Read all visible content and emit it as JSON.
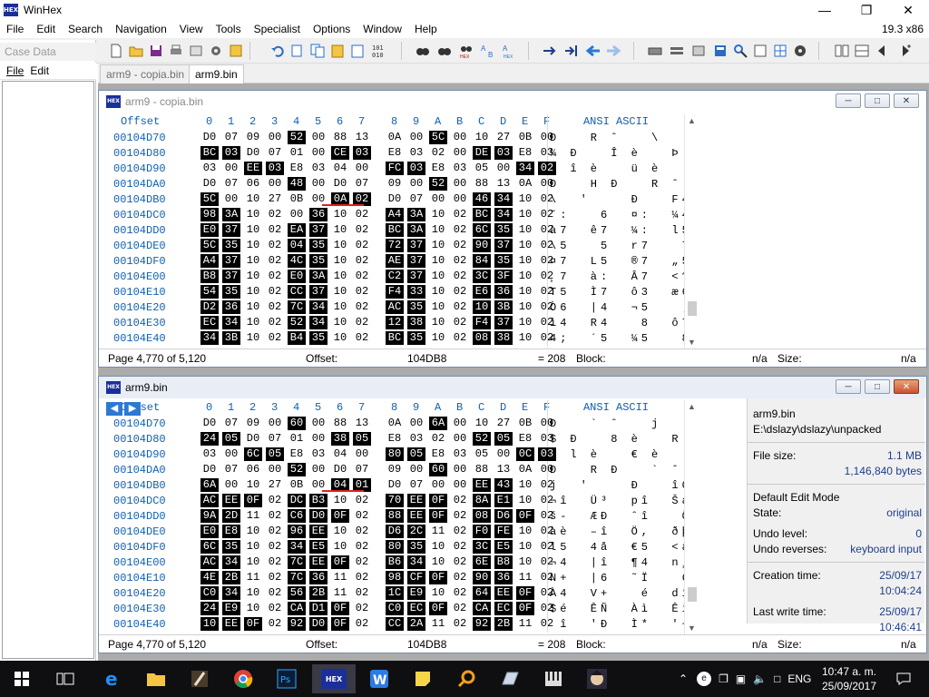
{
  "app": {
    "title": "WinHex",
    "logo_text": "HEX",
    "version": "19.3 x86"
  },
  "menu": [
    "File",
    "Edit",
    "Search",
    "Navigation",
    "View",
    "Tools",
    "Specialist",
    "Options",
    "Window",
    "Help"
  ],
  "case_panel": {
    "title": "Case Data",
    "menu": [
      "File",
      "Edit"
    ]
  },
  "tabs": [
    {
      "label": "arm9 - copia.bin",
      "active": false
    },
    {
      "label": "arm9.bin",
      "active": true
    }
  ],
  "hex_header": {
    "offset": "Offset",
    "columns": [
      "0",
      "1",
      "2",
      "3",
      "4",
      "5",
      "6",
      "7",
      "8",
      "9",
      "A",
      "B",
      "C",
      "D",
      "E",
      "F"
    ],
    "ascii": "ANSI ASCII"
  },
  "window1": {
    "title": "arm9 - copia.bin",
    "rows": [
      {
        "offset": "00104D70",
        "bytes": [
          "D0",
          "07",
          "09",
          "00",
          "52",
          "00",
          "88",
          "13",
          "0A",
          "00",
          "5C",
          "00",
          "10",
          "27",
          "0B",
          "00"
        ],
        "hi": [
          4,
          10
        ],
        "ascii": "Ð   R ˆ   \\  '"
      },
      {
        "offset": "00104D80",
        "bytes": [
          "BC",
          "03",
          "D0",
          "07",
          "01",
          "00",
          "CE",
          "03",
          "E8",
          "03",
          "02",
          "00",
          "DE",
          "03",
          "E8",
          "03"
        ],
        "hi": [
          0,
          1,
          6,
          7,
          12,
          13
        ],
        "ascii": "¼ Ð   Î è   Þ è"
      },
      {
        "offset": "00104D90",
        "bytes": [
          "03",
          "00",
          "EE",
          "03",
          "E8",
          "03",
          "04",
          "00",
          "FC",
          "03",
          "E8",
          "03",
          "05",
          "00",
          "34",
          "02"
        ],
        "hi": [
          2,
          3,
          8,
          9,
          14,
          15
        ],
        "ascii": "  î è   ü è   4"
      },
      {
        "offset": "00104DA0",
        "bytes": [
          "D0",
          "07",
          "06",
          "00",
          "48",
          "00",
          "D0",
          "07",
          "09",
          "00",
          "52",
          "00",
          "88",
          "13",
          "0A",
          "00"
        ],
        "hi": [
          4,
          10
        ],
        "ascii": "Ð   H Ð   R ˆ"
      },
      {
        "offset": "00104DB0",
        "bytes": [
          "5C",
          "00",
          "10",
          "27",
          "0B",
          "00",
          "0A",
          "02",
          "D0",
          "07",
          "00",
          "00",
          "46",
          "34",
          "10",
          "02"
        ],
        "hi": [
          0,
          6,
          7,
          12,
          13
        ],
        "ascii": "\\  '    Ð   F4"
      },
      {
        "offset": "00104DC0",
        "bytes": [
          "98",
          "3A",
          "10",
          "02",
          "00",
          "36",
          "10",
          "02",
          "A4",
          "3A",
          "10",
          "02",
          "BC",
          "34",
          "10",
          "02"
        ],
        "hi": [
          0,
          1,
          5,
          8,
          9,
          12,
          13
        ],
        "ascii": "˜:   6  ¤:  ¼4"
      },
      {
        "offset": "00104DD0",
        "bytes": [
          "E0",
          "37",
          "10",
          "02",
          "EA",
          "37",
          "10",
          "02",
          "BC",
          "3A",
          "10",
          "02",
          "6C",
          "35",
          "10",
          "02"
        ],
        "hi": [
          0,
          1,
          4,
          5,
          8,
          9,
          12,
          13
        ],
        "ascii": "à7  ê7  ¼:  l5"
      },
      {
        "offset": "00104DE0",
        "bytes": [
          "5C",
          "35",
          "10",
          "02",
          "04",
          "35",
          "10",
          "02",
          "72",
          "37",
          "10",
          "02",
          "90",
          "37",
          "10",
          "02"
        ],
        "hi": [
          0,
          1,
          4,
          5,
          8,
          9,
          12,
          13
        ],
        "ascii": "\\5   5  r7   7"
      },
      {
        "offset": "00104DF0",
        "bytes": [
          "A4",
          "37",
          "10",
          "02",
          "4C",
          "35",
          "10",
          "02",
          "AE",
          "37",
          "10",
          "02",
          "84",
          "35",
          "10",
          "02"
        ],
        "hi": [
          0,
          1,
          4,
          5,
          8,
          9,
          12,
          13
        ],
        "ascii": "¤7  L5  ®7  „5"
      },
      {
        "offset": "00104E00",
        "bytes": [
          "B8",
          "37",
          "10",
          "02",
          "E0",
          "3A",
          "10",
          "02",
          "C2",
          "37",
          "10",
          "02",
          "3C",
          "3F",
          "10",
          "02"
        ],
        "hi": [
          0,
          1,
          4,
          5,
          8,
          9,
          12,
          13
        ],
        "ascii": "¸7  à:  Â7  <?"
      },
      {
        "offset": "00104E10",
        "bytes": [
          "54",
          "35",
          "10",
          "02",
          "CC",
          "37",
          "10",
          "02",
          "F4",
          "33",
          "10",
          "02",
          "E6",
          "36",
          "10",
          "02"
        ],
        "hi": [
          0,
          1,
          4,
          5,
          8,
          9,
          12,
          13
        ],
        "ascii": "T5  Ì7  ô3  æ6"
      },
      {
        "offset": "00104E20",
        "bytes": [
          "D2",
          "36",
          "10",
          "02",
          "7C",
          "34",
          "10",
          "02",
          "AC",
          "35",
          "10",
          "02",
          "10",
          "3B",
          "10",
          "02"
        ],
        "hi": [
          0,
          1,
          4,
          5,
          8,
          9,
          12,
          13
        ],
        "ascii": "Ò6  |4  ¬5   ;"
      },
      {
        "offset": "00104E30",
        "bytes": [
          "EC",
          "34",
          "10",
          "02",
          "52",
          "34",
          "10",
          "02",
          "12",
          "38",
          "10",
          "02",
          "F4",
          "37",
          "10",
          "02"
        ],
        "hi": [
          0,
          1,
          4,
          5,
          8,
          9,
          12,
          13
        ],
        "ascii": "ì4  R4   8  ô7"
      },
      {
        "offset": "00104E40",
        "bytes": [
          "34",
          "3B",
          "10",
          "02",
          "B4",
          "35",
          "10",
          "02",
          "BC",
          "35",
          "10",
          "02",
          "08",
          "38",
          "10",
          "02"
        ],
        "hi": [
          0,
          1,
          4,
          5,
          8,
          9,
          12,
          13
        ],
        "ascii": "4;  ´5  ¼5   8"
      }
    ],
    "status": {
      "page": "Page 4,770 of 5,120",
      "offset_label": "Offset:",
      "offset_value": "104DB8",
      "value": "= 208",
      "block_label": "Block:",
      "block_value": "n/a",
      "size_label": "Size:",
      "size_value": "n/a"
    }
  },
  "window2": {
    "title": "arm9.bin",
    "rows": [
      {
        "offset": "00104D70",
        "bytes": [
          "D0",
          "07",
          "09",
          "00",
          "60",
          "00",
          "88",
          "13",
          "0A",
          "00",
          "6A",
          "00",
          "10",
          "27",
          "0B",
          "00"
        ],
        "hi": [
          4,
          10
        ],
        "ascii": "Ð   ` ˆ   j  '"
      },
      {
        "offset": "00104D80",
        "bytes": [
          "24",
          "05",
          "D0",
          "07",
          "01",
          "00",
          "38",
          "05",
          "E8",
          "03",
          "02",
          "00",
          "52",
          "05",
          "E8",
          "03"
        ],
        "hi": [
          0,
          1,
          6,
          7,
          12,
          13
        ],
        "ascii": "$ Ð   8 è   R è"
      },
      {
        "offset": "00104D90",
        "bytes": [
          "03",
          "00",
          "6C",
          "05",
          "E8",
          "03",
          "04",
          "00",
          "80",
          "05",
          "E8",
          "03",
          "05",
          "00",
          "0C",
          "03"
        ],
        "hi": [
          2,
          3,
          8,
          9,
          14,
          15
        ],
        "ascii": "  l è   € è"
      },
      {
        "offset": "00104DA0",
        "bytes": [
          "D0",
          "07",
          "06",
          "00",
          "52",
          "00",
          "D0",
          "07",
          "09",
          "00",
          "60",
          "00",
          "88",
          "13",
          "0A",
          "00"
        ],
        "hi": [
          4,
          10
        ],
        "ascii": "Ð   R Ð   ` ˆ"
      },
      {
        "offset": "00104DB0",
        "bytes": [
          "6A",
          "00",
          "10",
          "27",
          "0B",
          "00",
          "04",
          "01",
          "D0",
          "07",
          "00",
          "00",
          "EE",
          "43",
          "10",
          "02"
        ],
        "hi": [
          0,
          6,
          7,
          12,
          13
        ],
        "ascii": "j  '    Ð   îC"
      },
      {
        "offset": "00104DC0",
        "bytes": [
          "AC",
          "EE",
          "0F",
          "02",
          "DC",
          "B3",
          "10",
          "02",
          "70",
          "EE",
          "0F",
          "02",
          "8A",
          "E1",
          "10",
          "02"
        ],
        "hi": [
          0,
          1,
          2,
          4,
          5,
          8,
          9,
          10,
          12,
          13
        ],
        "ascii": "¬î  Ü³  pî  Šá"
      },
      {
        "offset": "00104DD0",
        "bytes": [
          "9A",
          "2D",
          "11",
          "02",
          "C6",
          "D0",
          "0F",
          "02",
          "88",
          "EE",
          "0F",
          "02",
          "08",
          "D6",
          "0F",
          "02"
        ],
        "hi": [
          0,
          1,
          4,
          5,
          6,
          8,
          9,
          10,
          12,
          13,
          14
        ],
        "ascii": "š-  ÆÐ  ˆî   Ö"
      },
      {
        "offset": "00104DE0",
        "bytes": [
          "E0",
          "E8",
          "10",
          "02",
          "96",
          "EE",
          "10",
          "02",
          "D6",
          "2C",
          "11",
          "02",
          "F0",
          "FE",
          "10",
          "02"
        ],
        "hi": [
          0,
          1,
          4,
          5,
          8,
          9,
          12,
          13
        ],
        "ascii": "àè  –î  Ö,  ðþ"
      },
      {
        "offset": "00104DF0",
        "bytes": [
          "6C",
          "35",
          "10",
          "02",
          "34",
          "E5",
          "10",
          "02",
          "80",
          "35",
          "10",
          "02",
          "3C",
          "E5",
          "10",
          "02"
        ],
        "hi": [
          0,
          1,
          4,
          5,
          8,
          9,
          12,
          13
        ],
        "ascii": "l5  4å  €5  <å"
      },
      {
        "offset": "00104E00",
        "bytes": [
          "AC",
          "34",
          "10",
          "02",
          "7C",
          "EE",
          "0F",
          "02",
          "B6",
          "34",
          "10",
          "02",
          "6E",
          "B8",
          "10",
          "02"
        ],
        "hi": [
          0,
          1,
          4,
          5,
          6,
          8,
          9,
          12,
          13
        ],
        "ascii": "¬4  |î  ¶4  n¸"
      },
      {
        "offset": "00104E10",
        "bytes": [
          "4E",
          "2B",
          "11",
          "02",
          "7C",
          "36",
          "11",
          "02",
          "98",
          "CF",
          "0F",
          "02",
          "90",
          "36",
          "11",
          "02"
        ],
        "hi": [
          0,
          1,
          4,
          5,
          8,
          9,
          10,
          12,
          13
        ],
        "ascii": "N+  |6  ˜Ï   6"
      },
      {
        "offset": "00104E20",
        "bytes": [
          "C0",
          "34",
          "10",
          "02",
          "56",
          "2B",
          "11",
          "02",
          "1C",
          "E9",
          "10",
          "02",
          "64",
          "EE",
          "0F",
          "02"
        ],
        "hi": [
          0,
          1,
          4,
          5,
          8,
          9,
          12,
          13,
          14
        ],
        "ascii": "À4  V+   é  dî"
      },
      {
        "offset": "00104E30",
        "bytes": [
          "24",
          "E9",
          "10",
          "02",
          "CA",
          "D1",
          "0F",
          "02",
          "C0",
          "EC",
          "0F",
          "02",
          "CA",
          "EC",
          "0F",
          "02"
        ],
        "hi": [
          0,
          1,
          4,
          5,
          6,
          8,
          9,
          10,
          12,
          13,
          14
        ],
        "ascii": "$é  ÊÑ  Àì  Êì"
      },
      {
        "offset": "00104E40",
        "bytes": [
          "10",
          "EE",
          "0F",
          "02",
          "92",
          "D0",
          "0F",
          "02",
          "CC",
          "2A",
          "11",
          "02",
          "92",
          "2B",
          "11",
          "02"
        ],
        "hi": [
          0,
          1,
          2,
          4,
          5,
          6,
          8,
          9,
          12,
          13
        ],
        "ascii": " î  'Ð  Ì*  '+"
      }
    ],
    "status": {
      "page": "Page 4,770 of 5,120",
      "offset_label": "Offset:",
      "offset_value": "104DB8",
      "value": "= 208",
      "block_label": "Block:",
      "block_value": "n/a",
      "size_label": "Size:",
      "size_value": "n/a"
    },
    "info": {
      "filename": "arm9.bin",
      "path": "E:\\dslazy\\dslazy\\unpacked",
      "file_size_label": "File size:",
      "file_size_mb": "1.1 MB",
      "file_size_bytes": "1,146,840 bytes",
      "edit_mode_label": "Default Edit Mode",
      "state_label": "State:",
      "state_value": "original",
      "undo_level_label": "Undo level:",
      "undo_level_value": "0",
      "undo_reverses_label": "Undo reverses:",
      "undo_reverses_value": "keyboard input",
      "creation_label": "Creation time:",
      "creation_date": "25/09/17",
      "creation_time": "10:04:24",
      "lastwrite_label": "Last write time:",
      "lastwrite_date": "25/09/17",
      "lastwrite_time": "10:46:41"
    }
  },
  "taskbar": {
    "lang": "ENG",
    "time": "10:47 a. m.",
    "date": "25/09/2017"
  }
}
